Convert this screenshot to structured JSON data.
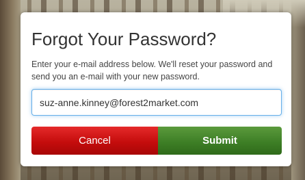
{
  "dialog": {
    "title": "Forgot Your Password?",
    "description": "Enter your e-mail address below. We'll reset your password and send you an e-mail with your new password.",
    "email_value": "suz-anne.kinney@forest2market.com",
    "cancel_label": "Cancel",
    "submit_label": "Submit"
  },
  "colors": {
    "cancel": "#c50d0d",
    "submit": "#3e7f26",
    "focus_border": "#66afe9"
  }
}
